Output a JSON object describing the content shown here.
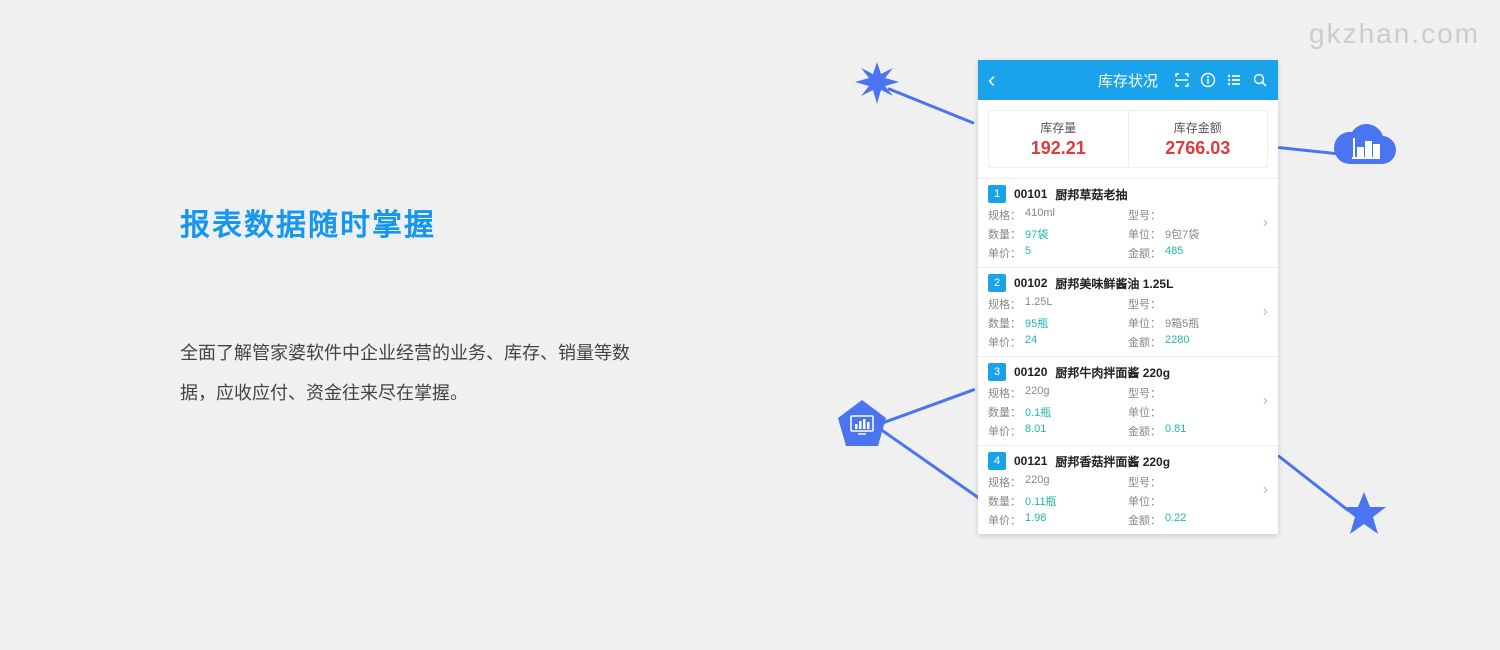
{
  "watermark": "gkzhan.com",
  "left": {
    "headline": "报表数据随时掌握",
    "description": "全面了解管家婆软件中企业经营的业务、库存、销量等数据，应收应付、资金往来尽在掌握。"
  },
  "phone": {
    "title": "库存状况",
    "summary": {
      "label1": "库存量",
      "value1": "192.21",
      "label2": "库存金额",
      "value2": "2766.03"
    },
    "labels": {
      "spec": "规格：",
      "model": "型号：",
      "qty": "数量：",
      "unit": "单位：",
      "price": "单价：",
      "amount": "金额："
    },
    "items": [
      {
        "num": "1",
        "code": "00101",
        "name": "厨邦草菇老抽",
        "spec": "410ml",
        "model": "",
        "qty": "97袋",
        "unit": "9包7袋",
        "price": "5",
        "amount": "485"
      },
      {
        "num": "2",
        "code": "00102",
        "name": "厨邦美味鲜酱油 1.25L",
        "spec": "1.25L",
        "model": "",
        "qty": "95瓶",
        "unit": "9箱5瓶",
        "price": "24",
        "amount": "2280"
      },
      {
        "num": "3",
        "code": "00120",
        "name": "厨邦牛肉拌面酱 220g",
        "spec": "220g",
        "model": "",
        "qty": "0.1瓶",
        "unit": "",
        "price": "8.01",
        "amount": "0.81"
      },
      {
        "num": "4",
        "code": "00121",
        "name": "厨邦香菇拌面酱 220g",
        "spec": "220g",
        "model": "",
        "qty": "0.11瓶",
        "unit": "",
        "price": "1.98",
        "amount": "0.22"
      }
    ]
  }
}
